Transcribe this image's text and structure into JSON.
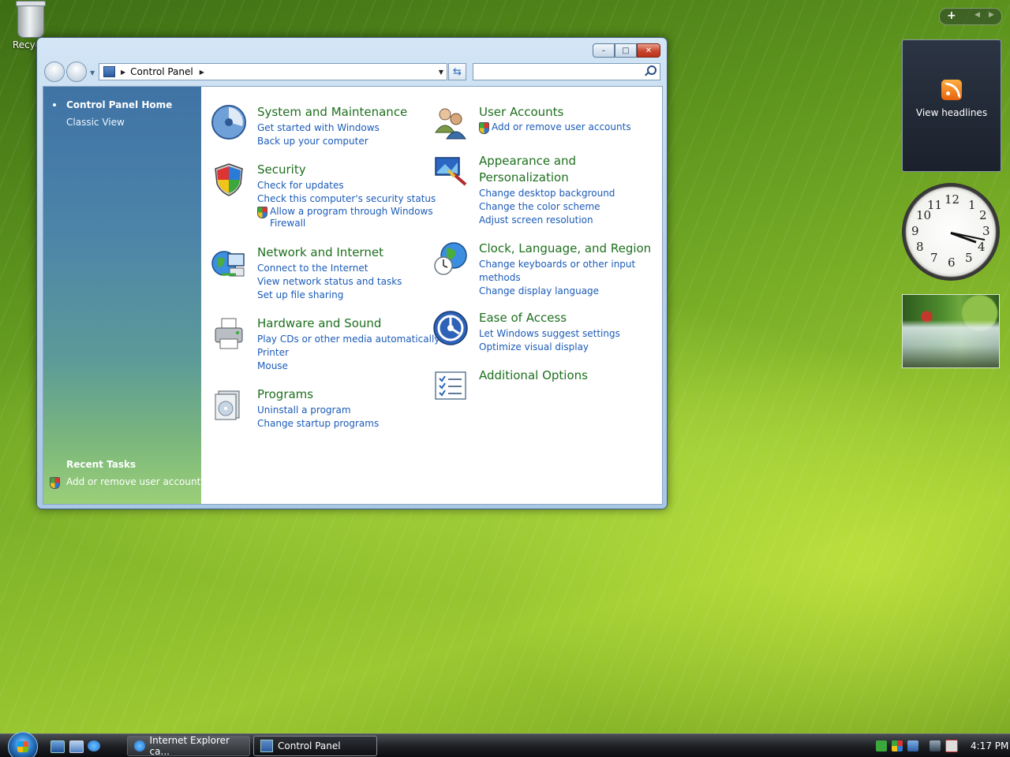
{
  "desktop": {
    "recycle_bin_label": "Recycle"
  },
  "window": {
    "title_buttons": {
      "minimize": "–",
      "maximize": "□",
      "close": "✕"
    },
    "address": {
      "crumb": "Control Panel"
    },
    "search": {
      "placeholder": ""
    },
    "sidebar": {
      "home": "Control Panel Home",
      "classic": "Classic View",
      "recent_title": "Recent Tasks",
      "recent_item": "Add or remove user accounts"
    },
    "categories": [
      {
        "title": "System and Maintenance",
        "links": [
          "Get started with Windows",
          "Back up your computer"
        ]
      },
      {
        "title": "Security",
        "links": [
          "Check for updates",
          "Check this computer's security status"
        ],
        "shield_link": "Allow a program through Windows Firewall"
      },
      {
        "title": "Network and Internet",
        "links": [
          "Connect to the Internet",
          "View network status and tasks",
          "Set up file sharing"
        ]
      },
      {
        "title": "Hardware and Sound",
        "links": [
          "Play CDs or other media automatically",
          "Printer",
          "Mouse"
        ]
      },
      {
        "title": "Programs",
        "links": [
          "Uninstall a program",
          "Change startup programs"
        ]
      },
      {
        "title": "User Accounts",
        "shield_link": "Add or remove user accounts"
      },
      {
        "title_line1": "Appearance and",
        "title_line2": "Personalization",
        "links": [
          "Change desktop background",
          "Change the color scheme",
          "Adjust screen resolution"
        ]
      },
      {
        "title": "Clock, Language, and Region",
        "links": [
          "Change keyboards or other input",
          "methods",
          "Change display language"
        ]
      },
      {
        "title": "Ease of Access",
        "links": [
          "Let Windows suggest settings",
          "Optimize visual display"
        ]
      },
      {
        "title": "Additional Options"
      }
    ]
  },
  "gadgets": {
    "feed_text": "View headlines",
    "clock_numbers": [
      "12",
      "1",
      "2",
      "3",
      "4",
      "5",
      "6",
      "7",
      "8",
      "9",
      "10",
      "11"
    ],
    "sidebar_plus": "+"
  },
  "taskbar": {
    "buttons": [
      "Internet Explorer ca...",
      "Control Panel"
    ],
    "time": "4:17 PM"
  },
  "colors": {
    "link": "#1b5bb8",
    "category_title": "#1e6f1e"
  }
}
